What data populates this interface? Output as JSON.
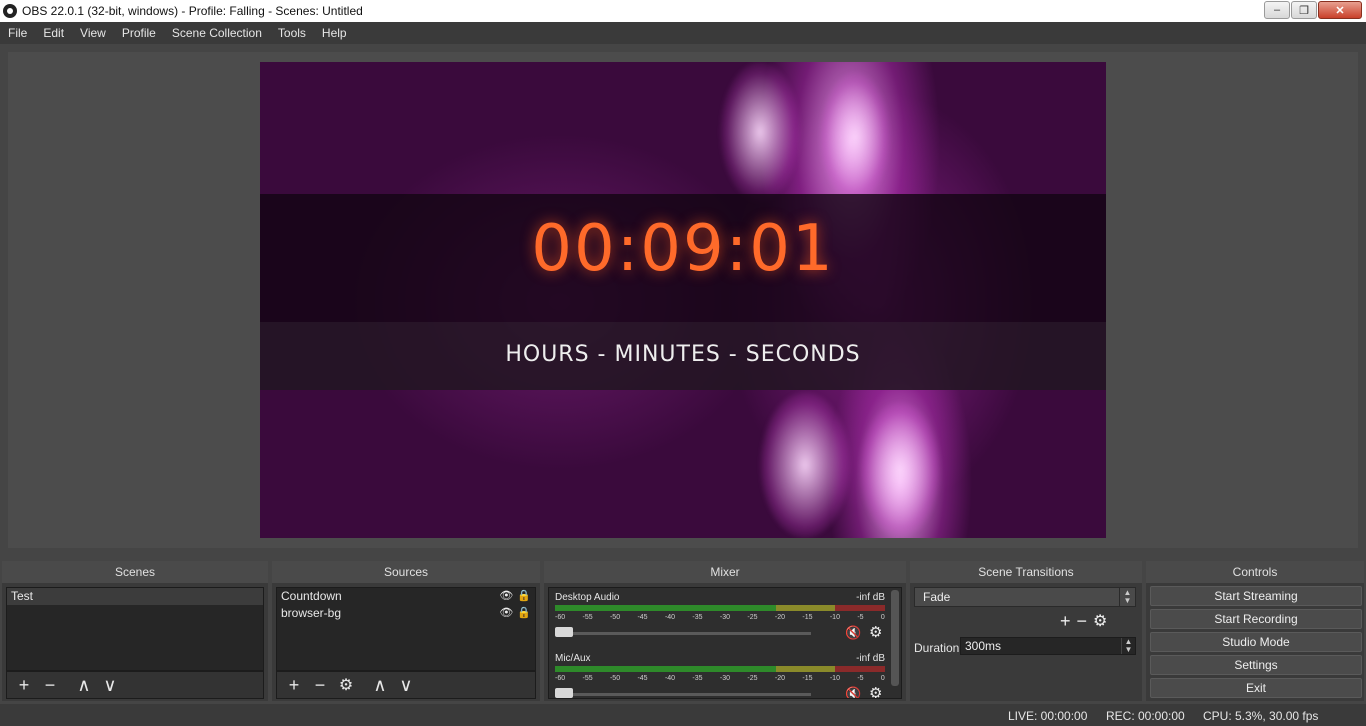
{
  "window": {
    "title": "OBS 22.0.1 (32-bit, windows) - Profile: Falling - Scenes: Untitled",
    "minimize_glyph": "‒",
    "restore_glyph": "❐",
    "close_glyph": "✕"
  },
  "menu": {
    "items": [
      "File",
      "Edit",
      "View",
      "Profile",
      "Scene Collection",
      "Tools",
      "Help"
    ]
  },
  "preview": {
    "timer": "00:09:01",
    "label": "HOURS - MINUTES - SECONDS"
  },
  "scenes": {
    "title": "Scenes",
    "items": [
      "Test"
    ]
  },
  "sources": {
    "title": "Sources",
    "items": [
      "Countdown",
      "browser-bg"
    ]
  },
  "mixer": {
    "title": "Mixer",
    "channels": [
      {
        "name": "Desktop Audio",
        "db": "-inf dB",
        "muted": true
      },
      {
        "name": "Mic/Aux",
        "db": "-inf dB",
        "muted": true
      }
    ],
    "ticks": [
      "-60",
      "-55",
      "-50",
      "-45",
      "-40",
      "-35",
      "-30",
      "-25",
      "-20",
      "-15",
      "-10",
      "-5",
      "0"
    ]
  },
  "transitions": {
    "title": "Scene Transitions",
    "selected": "Fade",
    "duration_label": "Duration",
    "duration_value": "300ms"
  },
  "controls": {
    "title": "Controls",
    "start_streaming": "Start Streaming",
    "start_recording": "Start Recording",
    "studio_mode": "Studio Mode",
    "settings": "Settings",
    "exit": "Exit"
  },
  "status": {
    "live": "LIVE: 00:00:00",
    "rec": "REC: 00:00:00",
    "cpu": "CPU: 5.3%, 30.00 fps"
  },
  "icons": {
    "add": "+",
    "remove": "−",
    "up": "∧",
    "down": "∨",
    "gear": "⚙",
    "eye": "👁",
    "lock": "🔒",
    "mute": "🔇"
  }
}
